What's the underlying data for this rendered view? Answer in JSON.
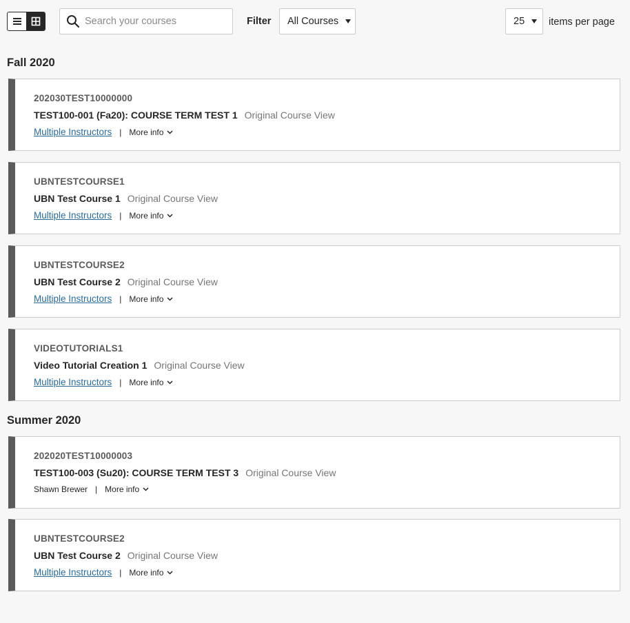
{
  "toolbar": {
    "search_placeholder": "Search your courses",
    "filter_label": "Filter",
    "filter_value": "All Courses",
    "per_page_value": "25",
    "per_page_label": "items per page"
  },
  "terms": [
    {
      "name": "Fall 2020",
      "courses": [
        {
          "id": "202030TEST10000000",
          "title": "TEST100-001 (Fa20): COURSE TERM TEST 1",
          "view": "Original Course View",
          "instructors": "Multiple Instructors",
          "more": "More info"
        },
        {
          "id": "UBNTESTCOURSE1",
          "title": "UBN Test Course 1",
          "view": "Original Course View",
          "instructors": "Multiple Instructors",
          "more": "More info"
        },
        {
          "id": "UBNTESTCOURSE2",
          "title": "UBN Test Course 2",
          "view": "Original Course View",
          "instructors": "Multiple Instructors",
          "more": "More info"
        },
        {
          "id": "VIDEOTUTORIALS1",
          "title": "Video Tutorial Creation 1",
          "view": "Original Course View",
          "instructors": "Multiple Instructors",
          "more": "More info"
        }
      ]
    },
    {
      "name": "Summer 2020",
      "courses": [
        {
          "id": "202020TEST10000003",
          "title": "TEST100-003 (Su20): COURSE TERM TEST 3",
          "view": "Original Course View",
          "instructors": "Shawn Brewer",
          "more": "More info"
        },
        {
          "id": "UBNTESTCOURSE2",
          "title": "UBN Test Course 2",
          "view": "Original Course View",
          "instructors": "Multiple Instructors",
          "more": "More info"
        }
      ]
    }
  ],
  "colors": {
    "accent_bar": "#5b5b5b",
    "link": "#2d6b96"
  }
}
